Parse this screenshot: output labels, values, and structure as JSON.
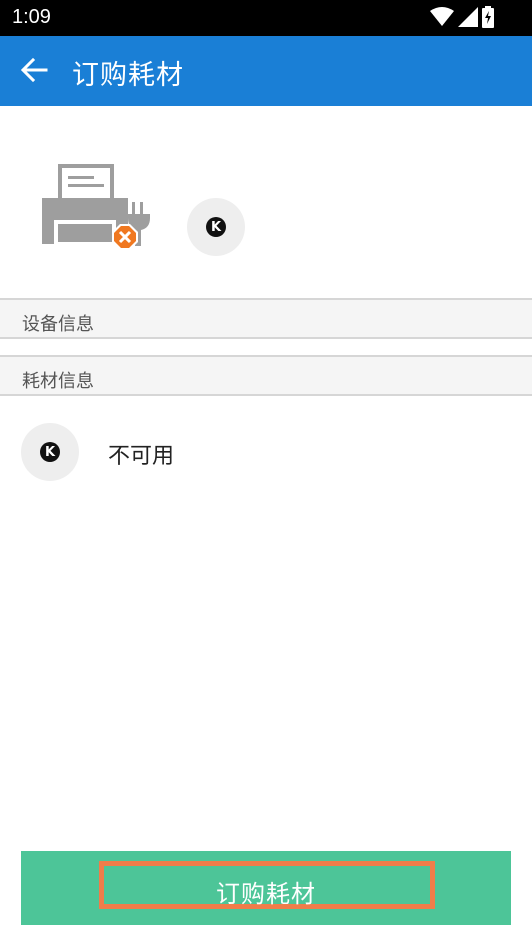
{
  "status_bar": {
    "time": "1:09",
    "icons": [
      "wifi-icon",
      "cell-signal-icon",
      "battery-charging-icon"
    ]
  },
  "app_bar": {
    "title": "订购耗材",
    "back_icon": "arrow-left-icon",
    "background_color": "#1a7fd6"
  },
  "device": {
    "printer_icon": "printer-offline-icon",
    "error_badge_color": "#f07820",
    "brand_logo": "K"
  },
  "sections": {
    "device_info": "设备信息",
    "supply_info": "耗材信息"
  },
  "supply": {
    "brand_logo": "K",
    "status": "不可用"
  },
  "order_button": {
    "label": "订购耗材",
    "background_color": "#4dc598",
    "highlight_color": "#f07d4a"
  }
}
